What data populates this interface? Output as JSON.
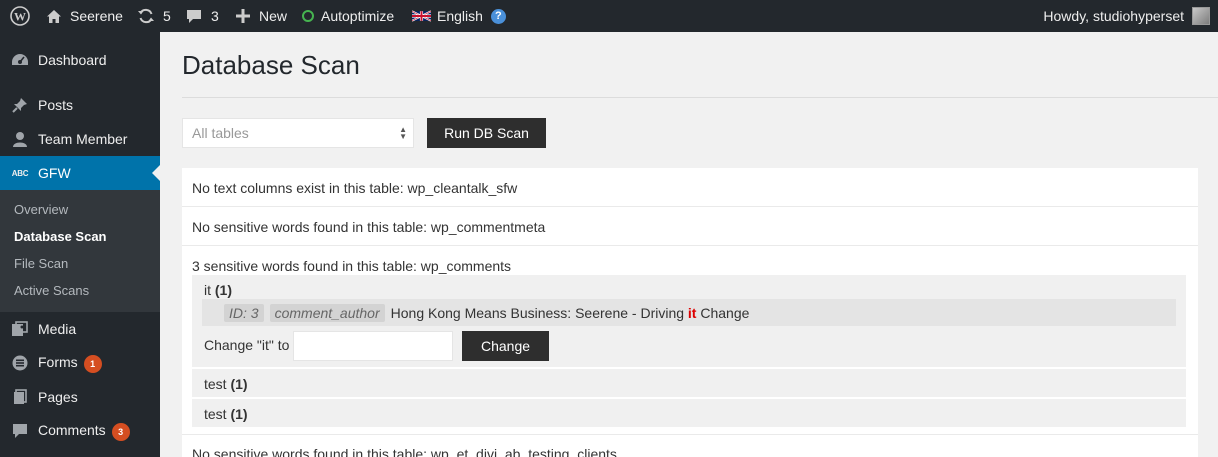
{
  "adminbar": {
    "site_name": "Seerene",
    "updates_count": "5",
    "comments_count": "3",
    "new_label": "New",
    "autoptimize_label": "Autoptimize",
    "language_label": "English",
    "help_glyph": "?",
    "greeting": "Howdy, studiohyperset",
    "colors": {
      "background": "#23282d",
      "autoptimize_status": "#46b450",
      "help": "#4a90d9"
    }
  },
  "sidebar": {
    "items": [
      {
        "label": "Dashboard",
        "icon": "dashboard-icon"
      },
      {
        "label": "Posts",
        "icon": "pin-icon"
      },
      {
        "label": "Team Member",
        "icon": "user-icon"
      },
      {
        "label": "GFW",
        "icon": "abc-icon",
        "icon_text": "ABC",
        "current": true
      },
      {
        "label": "Media",
        "icon": "media-icon"
      },
      {
        "label": "Forms",
        "icon": "forms-icon",
        "badge": "1"
      },
      {
        "label": "Pages",
        "icon": "pages-icon"
      },
      {
        "label": "Comments",
        "icon": "comments-icon",
        "badge": "3"
      }
    ],
    "submenu": [
      "Overview",
      "Database Scan",
      "File Scan",
      "Active Scans"
    ],
    "active_submenu": "Database Scan",
    "colors": {
      "current": "#0073aa",
      "badge": "#d54e21",
      "submenu_bg": "#32373c"
    }
  },
  "main": {
    "title": "Database Scan",
    "table_select": {
      "value": "All tables"
    },
    "run_button": "Run DB Scan",
    "results": [
      "No text columns exist in this table: wp_cleantalk_sfw",
      "No sensitive words found in this table: wp_commentmeta",
      "3 sensitive words found in this table: wp_comments"
    ],
    "words": [
      {
        "word": "it",
        "count": "(1)",
        "match": {
          "id_tag": "ID: 3",
          "column_tag": "comment_author",
          "text_before": "Hong Kong Means Business: Seerene - Driving",
          "highlight": "it",
          "text_after": "Change"
        },
        "change_label": "Change \"it\" to",
        "change_value": "",
        "change_button": "Change"
      },
      {
        "word": "test",
        "count": "(1)"
      },
      {
        "word": "test",
        "count": "(1)"
      }
    ],
    "partial_result": "No sensitive words found in this table: wp_et_divi_ab_testing_clients",
    "colors": {
      "highlight": "#dd0000",
      "button": "#2e2e2e"
    }
  }
}
